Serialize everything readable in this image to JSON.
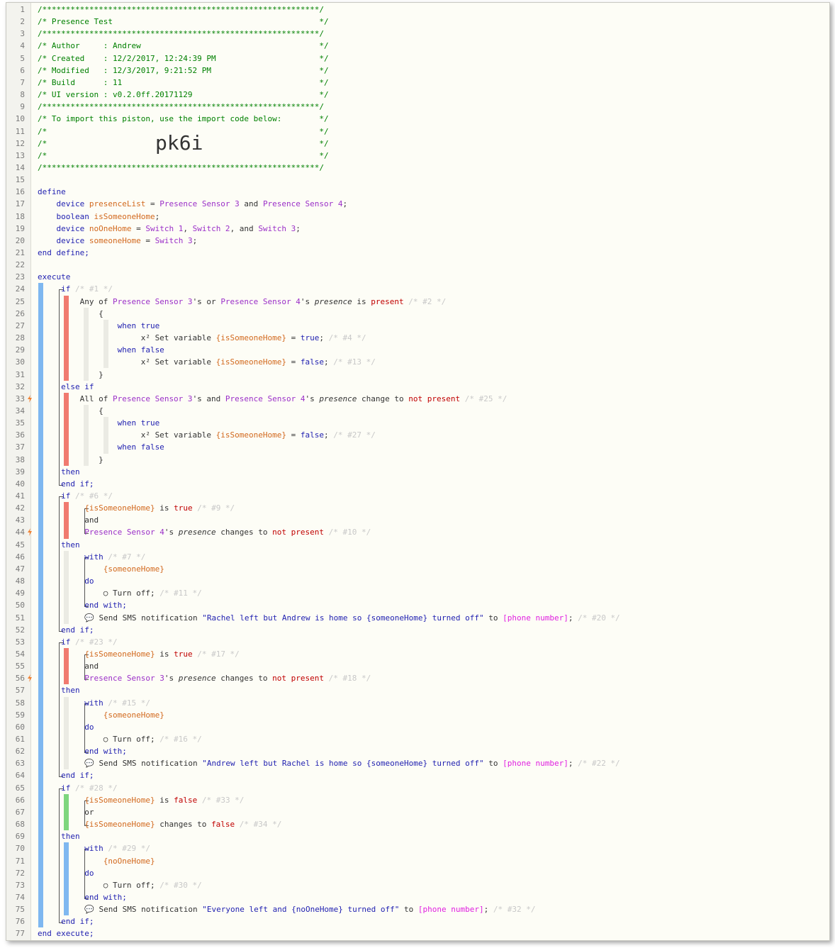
{
  "import_code": "pk6i",
  "colors": {
    "comment": "#008000",
    "keyword": "#1f1fb0",
    "variable": "#d2691e",
    "device": "#9b30c8",
    "value": "#c00000",
    "placeholder": "#e020e0",
    "bar_blue": "#7fb8f0",
    "bar_red": "#f07a70",
    "bar_green": "#7ed67e"
  },
  "lines": [
    [
      {
        "t": "/***********************************************************/",
        "c": "c"
      }
    ],
    [
      {
        "t": "/* Presence Test                                            */",
        "c": "c"
      }
    ],
    [
      {
        "t": "/***********************************************************/",
        "c": "c"
      }
    ],
    [
      {
        "t": "/* Author     : Andrew                                      */",
        "c": "c"
      }
    ],
    [
      {
        "t": "/* Created    : 12/2/2017, 12:24:39 PM                      */",
        "c": "c"
      }
    ],
    [
      {
        "t": "/* Modified   : 12/3/2017, 9:21:52 PM                       */",
        "c": "c"
      }
    ],
    [
      {
        "t": "/* Build      : 11                                          */",
        "c": "c"
      }
    ],
    [
      {
        "t": "/* UI version : v0.2.0ff.20171129                           */",
        "c": "c"
      }
    ],
    [
      {
        "t": "/***********************************************************/",
        "c": "c"
      }
    ],
    [
      {
        "t": "/* To import this piston, use the import code below:        */",
        "c": "c"
      }
    ],
    [
      {
        "t": "/*                                                          */",
        "c": "c"
      }
    ],
    [
      {
        "t": "/*                                                          */",
        "c": "c"
      }
    ],
    [
      {
        "t": "/*                                                          */",
        "c": "c"
      }
    ],
    [
      {
        "t": "/***********************************************************/",
        "c": "c"
      }
    ],
    [],
    [
      {
        "t": "define",
        "c": "k"
      }
    ],
    [
      {
        "t": "    device ",
        "c": "k"
      },
      {
        "t": "presenceList",
        "c": "v"
      },
      {
        "t": " = ",
        "c": ""
      },
      {
        "t": "Presence Sensor 3",
        "c": "dev"
      },
      {
        "t": " and ",
        "c": ""
      },
      {
        "t": "Presence Sensor 4",
        "c": "dev"
      },
      {
        "t": ";",
        "c": ""
      }
    ],
    [
      {
        "t": "    boolean ",
        "c": "k"
      },
      {
        "t": "isSomeoneHome",
        "c": "v"
      },
      {
        "t": ";",
        "c": ""
      }
    ],
    [
      {
        "t": "    device ",
        "c": "k"
      },
      {
        "t": "noOneHome",
        "c": "v"
      },
      {
        "t": " = ",
        "c": ""
      },
      {
        "t": "Switch 1",
        "c": "dev"
      },
      {
        "t": ", ",
        "c": ""
      },
      {
        "t": "Switch 2",
        "c": "dev"
      },
      {
        "t": ", and ",
        "c": ""
      },
      {
        "t": "Switch 3",
        "c": "dev"
      },
      {
        "t": ";",
        "c": ""
      }
    ],
    [
      {
        "t": "    device ",
        "c": "k"
      },
      {
        "t": "someoneHome",
        "c": "v"
      },
      {
        "t": " = ",
        "c": ""
      },
      {
        "t": "Switch 3",
        "c": "dev"
      },
      {
        "t": ";",
        "c": ""
      }
    ],
    [
      {
        "t": "end define;",
        "c": "k"
      }
    ],
    [],
    [
      {
        "t": "execute",
        "c": "k"
      }
    ],
    [
      {
        "t": "     if ",
        "c": "k"
      },
      {
        "t": "/* #1 */",
        "c": "cm"
      }
    ],
    [
      {
        "t": "         Any of ",
        "c": ""
      },
      {
        "t": "Presence Sensor 3",
        "c": "dev"
      },
      {
        "t": "'s or ",
        "c": ""
      },
      {
        "t": "Presence Sensor 4",
        "c": "dev"
      },
      {
        "t": "'s ",
        "c": ""
      },
      {
        "t": "presence",
        "c": "i"
      },
      {
        "t": " is ",
        "c": ""
      },
      {
        "t": "present",
        "c": "val"
      },
      {
        "t": " /* #2 */",
        "c": "cm"
      }
    ],
    [
      {
        "t": "             {",
        "c": ""
      }
    ],
    [
      {
        "t": "                 when true",
        "c": "k"
      }
    ],
    [
      {
        "t": "                      x² Set variable ",
        "c": ""
      },
      {
        "t": "{isSomeoneHome}",
        "c": "v"
      },
      {
        "t": " = ",
        "c": ""
      },
      {
        "t": "true",
        "c": "k"
      },
      {
        "t": "; ",
        "c": ""
      },
      {
        "t": "/* #4 */",
        "c": "cm"
      }
    ],
    [
      {
        "t": "                 when false",
        "c": "k"
      }
    ],
    [
      {
        "t": "                      x² Set variable ",
        "c": ""
      },
      {
        "t": "{isSomeoneHome}",
        "c": "v"
      },
      {
        "t": " = ",
        "c": ""
      },
      {
        "t": "false",
        "c": "k"
      },
      {
        "t": "; ",
        "c": ""
      },
      {
        "t": "/* #13 */",
        "c": "cm"
      }
    ],
    [
      {
        "t": "             }",
        "c": ""
      }
    ],
    [
      {
        "t": "     else if",
        "c": "k"
      }
    ],
    [
      {
        "t": "         All of ",
        "c": ""
      },
      {
        "t": "Presence Sensor 3",
        "c": "dev"
      },
      {
        "t": "'s and ",
        "c": ""
      },
      {
        "t": "Presence Sensor 4",
        "c": "dev"
      },
      {
        "t": "'s ",
        "c": ""
      },
      {
        "t": "presence",
        "c": "i"
      },
      {
        "t": " change to ",
        "c": ""
      },
      {
        "t": "not present",
        "c": "val"
      },
      {
        "t": " /* #25 */",
        "c": "cm"
      }
    ],
    [
      {
        "t": "             {",
        "c": ""
      }
    ],
    [
      {
        "t": "                 when true",
        "c": "k"
      }
    ],
    [
      {
        "t": "                      x² Set variable ",
        "c": ""
      },
      {
        "t": "{isSomeoneHome}",
        "c": "v"
      },
      {
        "t": " = ",
        "c": ""
      },
      {
        "t": "false",
        "c": "k"
      },
      {
        "t": "; ",
        "c": ""
      },
      {
        "t": "/* #27 */",
        "c": "cm"
      }
    ],
    [
      {
        "t": "                 when false",
        "c": "k"
      }
    ],
    [
      {
        "t": "             }",
        "c": ""
      }
    ],
    [
      {
        "t": "     then",
        "c": "k"
      }
    ],
    [
      {
        "t": "     end if;",
        "c": "k"
      }
    ],
    [
      {
        "t": "     if ",
        "c": "k"
      },
      {
        "t": "/* #6 */",
        "c": "cm"
      }
    ],
    [
      {
        "t": "          ",
        "c": ""
      },
      {
        "t": "{isSomeoneHome}",
        "c": "v"
      },
      {
        "t": " is ",
        "c": ""
      },
      {
        "t": "true",
        "c": "val"
      },
      {
        "t": " /* #9 */",
        "c": "cm"
      }
    ],
    [
      {
        "t": "          and",
        "c": ""
      }
    ],
    [
      {
        "t": "          ",
        "c": ""
      },
      {
        "t": "Presence Sensor 4",
        "c": "dev"
      },
      {
        "t": "'s ",
        "c": ""
      },
      {
        "t": "presence",
        "c": "i"
      },
      {
        "t": " changes to ",
        "c": ""
      },
      {
        "t": "not present",
        "c": "val"
      },
      {
        "t": " /* #10 */",
        "c": "cm"
      }
    ],
    [
      {
        "t": "     then",
        "c": "k"
      }
    ],
    [
      {
        "t": "          with ",
        "c": "k"
      },
      {
        "t": "/* #7 */",
        "c": "cm"
      }
    ],
    [
      {
        "t": "              ",
        "c": ""
      },
      {
        "t": "{someoneHome}",
        "c": "v"
      }
    ],
    [
      {
        "t": "          do",
        "c": "k"
      }
    ],
    [
      {
        "t": "              ○ Turn off; ",
        "c": ""
      },
      {
        "t": "/* #11 */",
        "c": "cm"
      }
    ],
    [
      {
        "t": "          end with;",
        "c": "k"
      }
    ],
    [
      {
        "t": "          💬 Send SMS notification ",
        "c": ""
      },
      {
        "t": "\"Rachel left but Andrew is home so {someoneHome} turned off\"",
        "c": "s"
      },
      {
        "t": " to ",
        "c": ""
      },
      {
        "t": "[phone number]",
        "c": "ph"
      },
      {
        "t": "; ",
        "c": ""
      },
      {
        "t": "/* #20 */",
        "c": "cm"
      }
    ],
    [
      {
        "t": "     end if;",
        "c": "k"
      }
    ],
    [
      {
        "t": "     if ",
        "c": "k"
      },
      {
        "t": "/* #23 */",
        "c": "cm"
      }
    ],
    [
      {
        "t": "          ",
        "c": ""
      },
      {
        "t": "{isSomeoneHome}",
        "c": "v"
      },
      {
        "t": " is ",
        "c": ""
      },
      {
        "t": "true",
        "c": "val"
      },
      {
        "t": " /* #17 */",
        "c": "cm"
      }
    ],
    [
      {
        "t": "          and",
        "c": ""
      }
    ],
    [
      {
        "t": "          ",
        "c": ""
      },
      {
        "t": "Presence Sensor 3",
        "c": "dev"
      },
      {
        "t": "'s ",
        "c": ""
      },
      {
        "t": "presence",
        "c": "i"
      },
      {
        "t": " changes to ",
        "c": ""
      },
      {
        "t": "not present",
        "c": "val"
      },
      {
        "t": " /* #18 */",
        "c": "cm"
      }
    ],
    [
      {
        "t": "     then",
        "c": "k"
      }
    ],
    [
      {
        "t": "          with ",
        "c": "k"
      },
      {
        "t": "/* #15 */",
        "c": "cm"
      }
    ],
    [
      {
        "t": "              ",
        "c": ""
      },
      {
        "t": "{someoneHome}",
        "c": "v"
      }
    ],
    [
      {
        "t": "          do",
        "c": "k"
      }
    ],
    [
      {
        "t": "              ○ Turn off; ",
        "c": ""
      },
      {
        "t": "/* #16 */",
        "c": "cm"
      }
    ],
    [
      {
        "t": "          end with;",
        "c": "k"
      }
    ],
    [
      {
        "t": "          💬 Send SMS notification ",
        "c": ""
      },
      {
        "t": "\"Andrew left but Rachel is home so {someoneHome} turned off\"",
        "c": "s"
      },
      {
        "t": " to ",
        "c": ""
      },
      {
        "t": "[phone number]",
        "c": "ph"
      },
      {
        "t": "; ",
        "c": ""
      },
      {
        "t": "/* #22 */",
        "c": "cm"
      }
    ],
    [
      {
        "t": "     end if;",
        "c": "k"
      }
    ],
    [
      {
        "t": "     if ",
        "c": "k"
      },
      {
        "t": "/* #28 */",
        "c": "cm"
      }
    ],
    [
      {
        "t": "          ",
        "c": ""
      },
      {
        "t": "{isSomeoneHome}",
        "c": "v"
      },
      {
        "t": " is ",
        "c": ""
      },
      {
        "t": "false",
        "c": "val"
      },
      {
        "t": " /* #33 */",
        "c": "cm"
      }
    ],
    [
      {
        "t": "          or",
        "c": ""
      }
    ],
    [
      {
        "t": "          ",
        "c": ""
      },
      {
        "t": "{isSomeoneHome}",
        "c": "v"
      },
      {
        "t": " changes to ",
        "c": ""
      },
      {
        "t": "false",
        "c": "val"
      },
      {
        "t": " /* #34 */",
        "c": "cm"
      }
    ],
    [
      {
        "t": "     then",
        "c": "k"
      }
    ],
    [
      {
        "t": "          with ",
        "c": "k"
      },
      {
        "t": "/* #29 */",
        "c": "cm"
      }
    ],
    [
      {
        "t": "              ",
        "c": ""
      },
      {
        "t": "{noOneHome}",
        "c": "v"
      }
    ],
    [
      {
        "t": "          do",
        "c": "k"
      }
    ],
    [
      {
        "t": "              ○ Turn off; ",
        "c": ""
      },
      {
        "t": "/* #30 */",
        "c": "cm"
      }
    ],
    [
      {
        "t": "          end with;",
        "c": "k"
      }
    ],
    [
      {
        "t": "          💬 Send SMS notification ",
        "c": ""
      },
      {
        "t": "\"Everyone left and {noOneHome} turned off\"",
        "c": "s"
      },
      {
        "t": " to ",
        "c": ""
      },
      {
        "t": "[phone number]",
        "c": "ph"
      },
      {
        "t": "; ",
        "c": ""
      },
      {
        "t": "/* #32 */",
        "c": "cm"
      }
    ],
    [
      {
        "t": "     end if;",
        "c": "k"
      }
    ],
    [
      {
        "t": "end execute;",
        "c": "k"
      }
    ]
  ],
  "trigger_lines": [
    33,
    44,
    56
  ]
}
